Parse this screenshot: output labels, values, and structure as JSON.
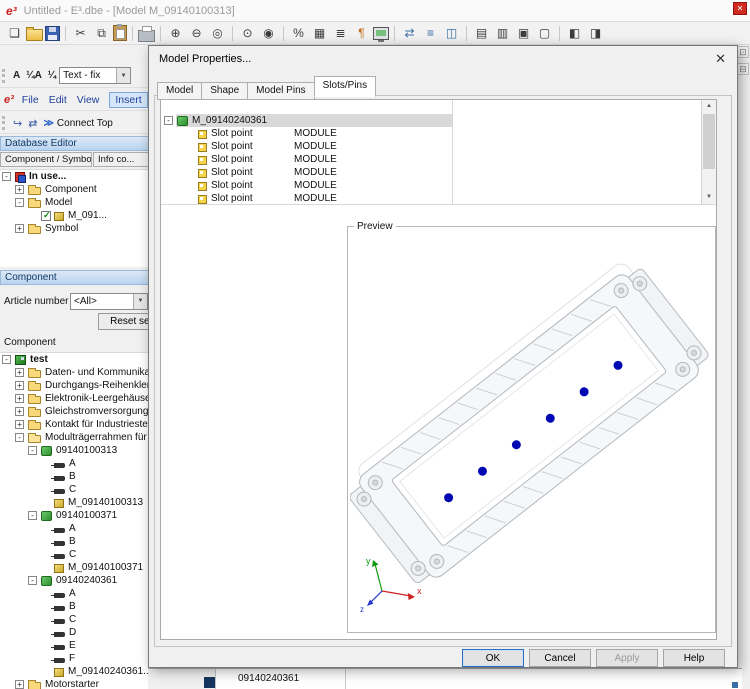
{
  "window": {
    "logo": "e³",
    "title": "Untitled - E³.dbe - [Model M_09140100313]",
    "close_glyph": "✕"
  },
  "toolbar": {
    "icons": [
      {
        "name": "new-file-icon",
        "glyph": "❏"
      },
      {
        "name": "open-folder-icon",
        "cls": "css-folder"
      },
      {
        "name": "save-icon",
        "cls": "css-floppy"
      },
      {
        "sep": true
      },
      {
        "name": "cut-icon",
        "glyph": "✂"
      },
      {
        "name": "copy-icon",
        "glyph": "⧉"
      },
      {
        "name": "paste-icon",
        "cls": "css-clip"
      },
      {
        "sep": true
      },
      {
        "name": "print-icon",
        "cls": "css-print"
      },
      {
        "sep": true
      },
      {
        "name": "zoom-in-icon",
        "glyph": "⊕"
      },
      {
        "name": "zoom-out-icon",
        "glyph": "⊖"
      },
      {
        "name": "zoom-fit-icon",
        "glyph": "◎"
      },
      {
        "sep": true
      },
      {
        "name": "center-view-icon",
        "glyph": "⊙"
      },
      {
        "name": "previous-view-icon",
        "glyph": "◉"
      },
      {
        "sep": true
      },
      {
        "name": "zoom-percent-icon",
        "glyph": "%"
      },
      {
        "name": "grid-icon",
        "glyph": "▦"
      },
      {
        "name": "sheet-list-icon",
        "glyph": "≣"
      },
      {
        "name": "pilcrow-icon",
        "glyph": "¶",
        "color": "#c06a1a"
      },
      {
        "name": "screen-icon",
        "cls": "css-monitor"
      },
      {
        "sep": true
      },
      {
        "name": "swap-panels-icon",
        "glyph": "⇄",
        "color": "#3a6ea5"
      },
      {
        "name": "tree-view-icon",
        "glyph": "≡",
        "color": "#3a6ea5"
      },
      {
        "name": "panel-view-icon",
        "glyph": "◫",
        "color": "#3a6ea5"
      },
      {
        "sep": true
      },
      {
        "name": "tile-horizontal-icon",
        "glyph": "▤"
      },
      {
        "name": "tile-vertical-icon",
        "glyph": "▥"
      },
      {
        "name": "cascade-windows-icon",
        "glyph": "▣"
      },
      {
        "name": "arrange-icons-icon",
        "glyph": "▢"
      },
      {
        "sep": true
      },
      {
        "name": "column-left-icon",
        "glyph": "◧"
      },
      {
        "name": "column-right-icon",
        "glyph": "◨"
      }
    ]
  },
  "right_strip": {
    "icons": [
      {
        "name": "right-toolbar-icon-1",
        "glyph": "⊡"
      },
      {
        "name": "right-toolbar-icon-2",
        "glyph": "⊟"
      }
    ]
  },
  "left": {
    "text_toolbar": {
      "icons": [
        {
          "name": "text-style-icon",
          "glyph": "A"
        },
        {
          "name": "text-scale-icon",
          "glyph": "¼A"
        },
        {
          "name": "text-fraction-icon",
          "glyph": "¼"
        }
      ],
      "value": "Text - fix",
      "arrow": "▼"
    },
    "menu": {
      "logo": "e³",
      "items": [
        "File",
        "Edit",
        "View",
        "Insert"
      ],
      "active": "Insert"
    },
    "connect": {
      "icons": [
        {
          "name": "connect-arrow-icon",
          "glyph": "↪"
        },
        {
          "name": "connect-swap-icon",
          "glyph": "⇄"
        }
      ],
      "chevrons": "≫",
      "label": "Connect Top"
    },
    "db_editor": {
      "header": "Database Editor",
      "tabs": [
        "Component / Symbol",
        "Info co..."
      ],
      "tree": [
        {
          "lvl": 0,
          "exp": "-",
          "icon": "inuse",
          "label": "In use...",
          "bold": true
        },
        {
          "lvl": 1,
          "exp": "+",
          "icon": "folder",
          "label": "Component"
        },
        {
          "lvl": 1,
          "exp": "-",
          "icon": "folder",
          "label": "Model"
        },
        {
          "lvl": 2,
          "exp": "",
          "icon": "model",
          "label": "M_091...",
          "checked": true
        },
        {
          "lvl": 1,
          "exp": "+",
          "icon": "folder",
          "label": "Symbol"
        }
      ]
    },
    "component_panel": {
      "header": "Component",
      "article_label": "Article number",
      "article_value": "<All>",
      "combo_arrow": "▼",
      "reset_label": "Reset se...",
      "section_label": "Component",
      "tree": [
        {
          "lvl": 0,
          "exp": "-",
          "icon": "compbox",
          "label": "test",
          "bold": true
        },
        {
          "lvl": 1,
          "exp": "+",
          "icon": "folder",
          "label": "Daten- und Kommunikatio..."
        },
        {
          "lvl": 1,
          "exp": "+",
          "icon": "folder",
          "label": "Durchgangs-Reihenklemm..."
        },
        {
          "lvl": 1,
          "exp": "+",
          "icon": "folder",
          "label": "Elektronik-Leergehäuse"
        },
        {
          "lvl": 1,
          "exp": "+",
          "icon": "folder",
          "label": "Gleichstromversorgung"
        },
        {
          "lvl": 1,
          "exp": "+",
          "icon": "folder",
          "label": "Kontakt für Industriesteck..."
        },
        {
          "lvl": 1,
          "exp": "-",
          "icon": "folderopen",
          "label": "Modulträgerrahmen für In..."
        },
        {
          "lvl": 2,
          "exp": "-",
          "icon": "device",
          "label": "09140100313"
        },
        {
          "lvl": 3,
          "exp": "",
          "icon": "pin",
          "label": "A"
        },
        {
          "lvl": 3,
          "exp": "",
          "icon": "pin",
          "label": "B"
        },
        {
          "lvl": 3,
          "exp": "",
          "icon": "pin",
          "label": "C"
        },
        {
          "lvl": 3,
          "exp": "",
          "icon": "model",
          "label": "M_09140100313"
        },
        {
          "lvl": 2,
          "exp": "-",
          "icon": "device",
          "label": "09140100371"
        },
        {
          "lvl": 3,
          "exp": "",
          "icon": "pin",
          "label": "A"
        },
        {
          "lvl": 3,
          "exp": "",
          "icon": "pin",
          "label": "B"
        },
        {
          "lvl": 3,
          "exp": "",
          "icon": "pin",
          "label": "C"
        },
        {
          "lvl": 3,
          "exp": "",
          "icon": "model",
          "label": "M_09140100371"
        },
        {
          "lvl": 2,
          "exp": "-",
          "icon": "device",
          "label": "09140240361"
        },
        {
          "lvl": 3,
          "exp": "",
          "icon": "pin",
          "label": "A"
        },
        {
          "lvl": 3,
          "exp": "",
          "icon": "pin",
          "label": "B"
        },
        {
          "lvl": 3,
          "exp": "",
          "icon": "pin",
          "label": "C"
        },
        {
          "lvl": 3,
          "exp": "",
          "icon": "pin",
          "label": "D"
        },
        {
          "lvl": 3,
          "exp": "",
          "icon": "pin",
          "label": "E"
        },
        {
          "lvl": 3,
          "exp": "",
          "icon": "pin",
          "label": "F"
        },
        {
          "lvl": 3,
          "exp": "",
          "icon": "model",
          "label": "M_09140240361..."
        },
        {
          "lvl": 1,
          "exp": "+",
          "icon": "folder",
          "label": "Motorstarter"
        }
      ]
    }
  },
  "bottom": {
    "cell": "09140240361"
  },
  "dialog": {
    "title": "Model Properties...",
    "close_glyph": "✕",
    "tabs": [
      "Model",
      "Shape",
      "Model Pins",
      "Slots/Pins"
    ],
    "active_tab": 3,
    "slot_root": {
      "label": "M_09140240361",
      "exp": "-"
    },
    "slot_rows": [
      {
        "label": "Slot point",
        "value": "MODULE"
      },
      {
        "label": "Slot point",
        "value": "MODULE"
      },
      {
        "label": "Slot point",
        "value": "MODULE"
      },
      {
        "label": "Slot point",
        "value": "MODULE"
      },
      {
        "label": "Slot point",
        "value": "MODULE"
      },
      {
        "label": "Slot point",
        "value": "MODULE"
      }
    ],
    "scrollbar": {
      "up": "▲",
      "down": "▼"
    },
    "preview_label": "Preview",
    "axes": {
      "x": "x",
      "y": "y",
      "z": "z"
    },
    "dot_color": "#0008b4",
    "buttons": [
      {
        "label": "OK",
        "state": "default"
      },
      {
        "label": "Cancel",
        "state": "normal"
      },
      {
        "label": "Apply",
        "state": "disabled"
      },
      {
        "label": "Help",
        "state": "normal"
      }
    ]
  }
}
